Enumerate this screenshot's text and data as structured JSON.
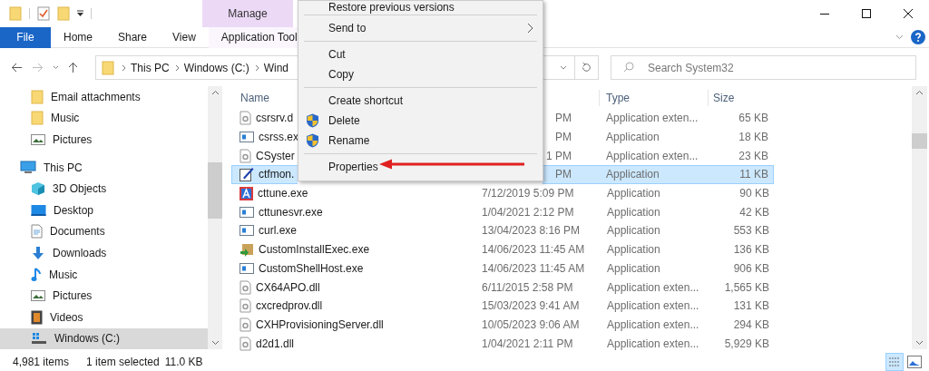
{
  "ribbon": {
    "context_header": "Manage",
    "tabs": [
      {
        "label": "File",
        "kind": "file"
      },
      {
        "label": "Home",
        "kind": "plain"
      },
      {
        "label": "Share",
        "kind": "plain"
      },
      {
        "label": "View",
        "kind": "plain"
      },
      {
        "label": "Application Tool",
        "kind": "context"
      }
    ]
  },
  "address": {
    "crumbs": [
      "This PC",
      "Windows (C:)",
      "Wind"
    ]
  },
  "search": {
    "placeholder": "Search System32"
  },
  "nav": [
    {
      "label": "Email attachments",
      "kind": "folder",
      "selected": false
    },
    {
      "label": "Music",
      "kind": "folder",
      "selected": false
    },
    {
      "label": "Pictures",
      "kind": "pictures",
      "selected": false
    },
    {
      "label": "This PC",
      "kind": "pc",
      "selected": false,
      "children": [
        {
          "label": "3D Objects",
          "kind": "objects",
          "selected": false
        },
        {
          "label": "Desktop",
          "kind": "desktop",
          "selected": false
        },
        {
          "label": "Documents",
          "kind": "documents",
          "selected": false
        },
        {
          "label": "Downloads",
          "kind": "downloads",
          "selected": false
        },
        {
          "label": "Music",
          "kind": "music",
          "selected": false
        },
        {
          "label": "Pictures",
          "kind": "pictures",
          "selected": false
        },
        {
          "label": "Videos",
          "kind": "videos",
          "selected": false
        },
        {
          "label": "Windows (C:)",
          "kind": "drive",
          "selected": true
        }
      ]
    }
  ],
  "columns": {
    "name": "Name",
    "type": "Type",
    "size": "Size"
  },
  "rows": [
    {
      "name": "csrsrv.d",
      "date": "PM",
      "type": "Application exten...",
      "size": "65 KB",
      "kind": "dll",
      "covered": true,
      "selected": false
    },
    {
      "name": "csrss.ex",
      "date": "PM",
      "type": "Application",
      "size": "18 KB",
      "kind": "exe",
      "covered": true,
      "selected": false
    },
    {
      "name": "CSyster",
      "date": "1 PM",
      "type": "Application exten...",
      "size": "23 KB",
      "kind": "dll",
      "covered": true,
      "selected": false
    },
    {
      "name": "ctfmon.",
      "date": "PM",
      "type": "Application",
      "size": "11 KB",
      "kind": "pen",
      "covered": true,
      "selected": true
    },
    {
      "name": "cttune.exe",
      "date": "7/12/2019 5:09 PM",
      "type": "Application",
      "size": "90 KB",
      "kind": "font",
      "covered": false,
      "selected": false
    },
    {
      "name": "cttunesvr.exe",
      "date": "1/04/2021 2:12 PM",
      "type": "Application",
      "size": "42 KB",
      "kind": "exe",
      "covered": false,
      "selected": false
    },
    {
      "name": "curl.exe",
      "date": "13/04/2023 8:16 PM",
      "type": "Application",
      "size": "553 KB",
      "kind": "exe",
      "covered": false,
      "selected": false
    },
    {
      "name": "CustomInstallExec.exe",
      "date": "14/06/2023 11:45 AM",
      "type": "Application",
      "size": "136 KB",
      "kind": "install",
      "covered": false,
      "selected": false
    },
    {
      "name": "CustomShellHost.exe",
      "date": "14/06/2023 11:45 AM",
      "type": "Application",
      "size": "906 KB",
      "kind": "exe",
      "covered": false,
      "selected": false
    },
    {
      "name": "CX64APO.dll",
      "date": "6/11/2015 2:58 PM",
      "type": "Application exten...",
      "size": "1,565 KB",
      "kind": "dll",
      "covered": false,
      "selected": false
    },
    {
      "name": "cxcredprov.dll",
      "date": "15/03/2023 9:41 AM",
      "type": "Application exten...",
      "size": "131 KB",
      "kind": "dll",
      "covered": false,
      "selected": false
    },
    {
      "name": "CXHProvisioningServer.dll",
      "date": "10/05/2023 9:06 AM",
      "type": "Application exten...",
      "size": "294 KB",
      "kind": "dll",
      "covered": false,
      "selected": false
    },
    {
      "name": "d2d1.dll",
      "date": "1/04/2021 2:11 PM",
      "type": "Application exten...",
      "size": "5,929 KB",
      "kind": "dll",
      "covered": false,
      "selected": false
    }
  ],
  "menu": [
    [
      {
        "label": "Restore previous versions",
        "kind": "plain"
      }
    ],
    [
      {
        "label": "Send to",
        "kind": "submenu"
      }
    ],
    [
      {
        "label": "Cut",
        "kind": "plain"
      },
      {
        "label": "Copy",
        "kind": "plain"
      }
    ],
    [
      {
        "label": "Create shortcut",
        "kind": "plain"
      },
      {
        "label": "Delete",
        "kind": "shield"
      },
      {
        "label": "Rename",
        "kind": "shield"
      }
    ],
    [
      {
        "label": "Properties",
        "kind": "plain"
      }
    ]
  ],
  "status": {
    "count": "4,981 items",
    "selection": "1 item selected",
    "selection_size": "11.0 KB"
  }
}
